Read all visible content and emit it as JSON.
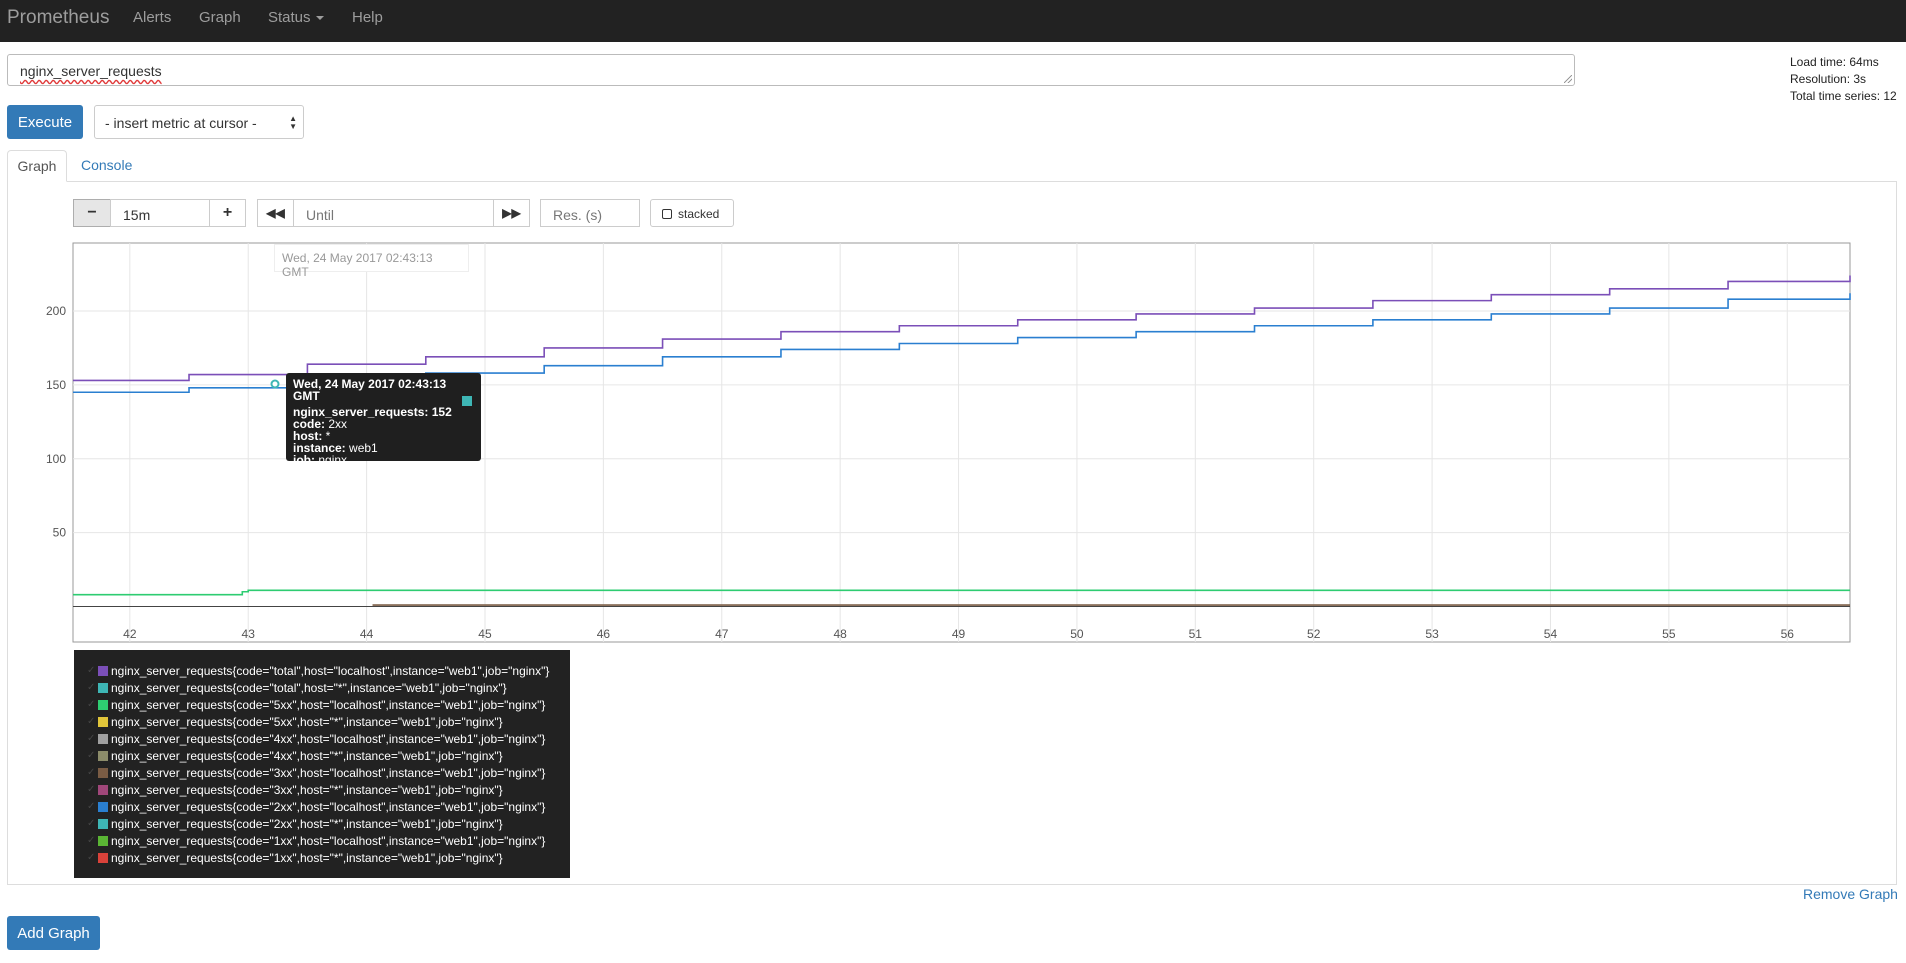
{
  "navbar": {
    "brand": "Prometheus",
    "items": [
      {
        "label": "Alerts"
      },
      {
        "label": "Graph"
      },
      {
        "label": "Status"
      },
      {
        "label": "Help"
      }
    ]
  },
  "query": {
    "expression": "nginx_server_requests",
    "execute_label": "Execute",
    "metric_select": "- insert metric at cursor -"
  },
  "stats": {
    "load_time": "Load time: 64ms",
    "resolution": "Resolution: 3s",
    "total_series": "Total time series: 12"
  },
  "tabs": [
    {
      "label": "Graph",
      "active": true
    },
    {
      "label": "Console",
      "active": false
    }
  ],
  "controls": {
    "range": "15m",
    "until_placeholder": "Until",
    "res_placeholder": "Res. (s)",
    "stacked_label": "stacked"
  },
  "hover_time": "Wed, 24 May 2017 02:43:13 GMT",
  "hover_tooltip": {
    "title": "Wed, 24 May 2017 02:43:13 GMT",
    "value_label": "nginx_server_requests:",
    "value": "152",
    "lines": [
      {
        "key": "code:",
        "val": "2xx"
      },
      {
        "key": "host:",
        "val": "*"
      },
      {
        "key": "instance:",
        "val": "web1"
      },
      {
        "key": "job:",
        "val": "nginx"
      }
    ]
  },
  "chart_data": {
    "type": "line",
    "x_ticks": [
      "42",
      "43",
      "44",
      "45",
      "46",
      "47",
      "48",
      "49",
      "50",
      "51",
      "52",
      "53",
      "54",
      "55",
      "56"
    ],
    "y_ticks": [
      "50",
      "100",
      "150",
      "200"
    ],
    "xlim": [
      41.52,
      56.53
    ],
    "ylim": [
      -24,
      246
    ],
    "grid": true,
    "series": [
      {
        "name": "nginx_server_requests{code=\"total\",host=\"localhost\",instance=\"web1\",job=\"nginx\"}",
        "color": "#7b4fb8",
        "x": [
          41.52,
          42.5,
          43.5,
          44.5,
          45.5,
          46.5,
          47.5,
          48.5,
          49.5,
          50.5,
          51.5,
          52.5,
          53.5,
          54.5,
          55.5,
          56.53
        ],
        "y": [
          153,
          157,
          164,
          169,
          175,
          181,
          186,
          190,
          194,
          198,
          202,
          207,
          211,
          215,
          220,
          224
        ]
      },
      {
        "name": "nginx_server_requests{code=\"total\",host=\"*\",instance=\"web1\",job=\"nginx\"}",
        "color": "#3eb6b5",
        "x": [],
        "y": []
      },
      {
        "name": "nginx_server_requests{code=\"5xx\",host=\"localhost\",instance=\"web1\",job=\"nginx\"}",
        "color": "#2ecc71",
        "x": [
          41.52,
          42.8,
          42.95,
          43.0,
          56.53
        ],
        "y": [
          8,
          8,
          10,
          11,
          11
        ]
      },
      {
        "name": "nginx_server_requests{code=\"5xx\",host=\"*\",instance=\"web1\",job=\"nginx\"}",
        "color": "#e0c53a",
        "x": [],
        "y": []
      },
      {
        "name": "nginx_server_requests{code=\"4xx\",host=\"localhost\",instance=\"web1\",job=\"nginx\"}",
        "color": "#a0a0a0",
        "x": [],
        "y": []
      },
      {
        "name": "nginx_server_requests{code=\"4xx\",host=\"*\",instance=\"web1\",job=\"nginx\"}",
        "color": "#8c8c6a",
        "x": [],
        "y": []
      },
      {
        "name": "nginx_server_requests{code=\"3xx\",host=\"localhost\",instance=\"web1\",job=\"nginx\"}",
        "color": "#7a5c44",
        "x": [
          44.05,
          56.53
        ],
        "y": [
          1,
          1
        ]
      },
      {
        "name": "nginx_server_requests{code=\"3xx\",host=\"*\",instance=\"web1\",job=\"nginx\"}",
        "color": "#a0477a",
        "x": [],
        "y": []
      },
      {
        "name": "nginx_server_requests{code=\"2xx\",host=\"localhost\",instance=\"web1\",job=\"nginx\"}",
        "color": "#2a7fd0",
        "x": [
          41.52,
          42.5,
          43.5,
          44.5,
          45.5,
          46.5,
          47.5,
          48.5,
          49.5,
          50.5,
          51.5,
          52.5,
          53.5,
          54.5,
          55.5,
          56.53
        ],
        "y": [
          145,
          148,
          153,
          158,
          163,
          169,
          174,
          178,
          182,
          186,
          190,
          194,
          198,
          202,
          208,
          212
        ]
      },
      {
        "name": "nginx_server_requests{code=\"2xx\",host=\"*\",instance=\"web1\",job=\"nginx\"}",
        "color": "#3eb6b5",
        "x": [],
        "y": []
      },
      {
        "name": "nginx_server_requests{code=\"1xx\",host=\"localhost\",instance=\"web1\",job=\"nginx\"}",
        "color": "#5ab534",
        "x": [],
        "y": []
      },
      {
        "name": "nginx_server_requests{code=\"1xx\",host=\"*\",instance=\"web1\",job=\"nginx\"}",
        "color": "#d9423a",
        "x": [],
        "y": []
      }
    ]
  },
  "remove_graph_label": "Remove Graph",
  "add_graph_label": "Add Graph"
}
